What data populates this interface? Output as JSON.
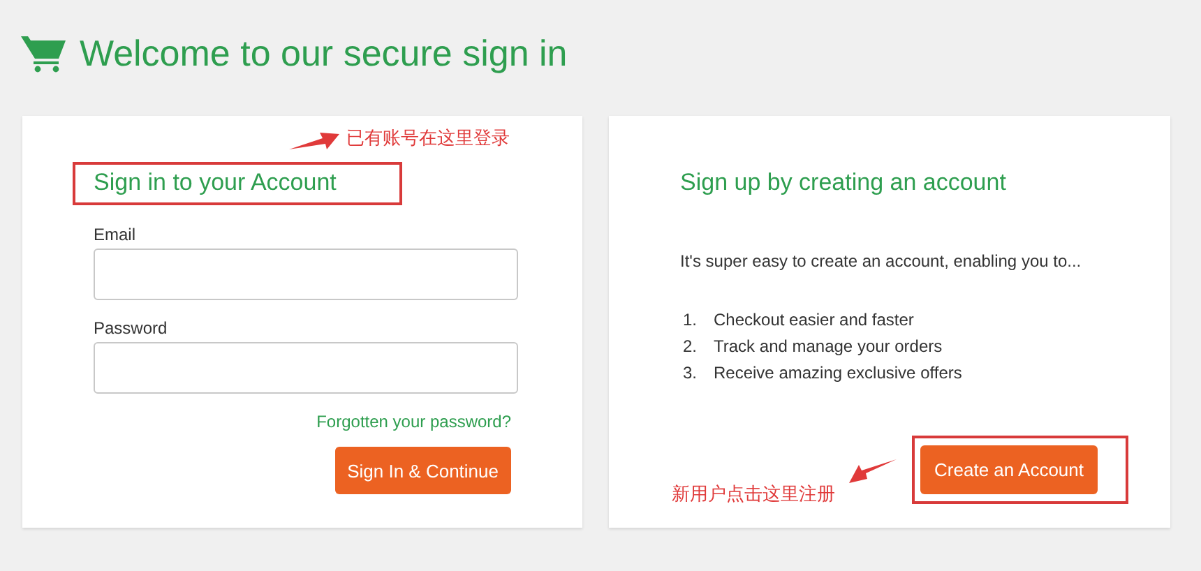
{
  "header": {
    "title": "Welcome to our secure sign in"
  },
  "signin": {
    "heading": "Sign in to your Account",
    "annotation": "已有账号在这里登录",
    "email": {
      "label": "Email"
    },
    "password": {
      "label": "Password"
    },
    "forgot_link": "Forgotten your password?",
    "button": "Sign In & Continue"
  },
  "signup": {
    "heading": "Sign up by creating an account",
    "intro": "It's super easy to create an account, enabling you to...",
    "benefits": [
      {
        "number": "1.",
        "text": "Checkout easier and faster"
      },
      {
        "number": "2.",
        "text": "Track and manage your orders"
      },
      {
        "number": "3.",
        "text": "Receive amazing exclusive offers"
      }
    ],
    "button": "Create an Account",
    "annotation": "新用户点击这里注册"
  }
}
